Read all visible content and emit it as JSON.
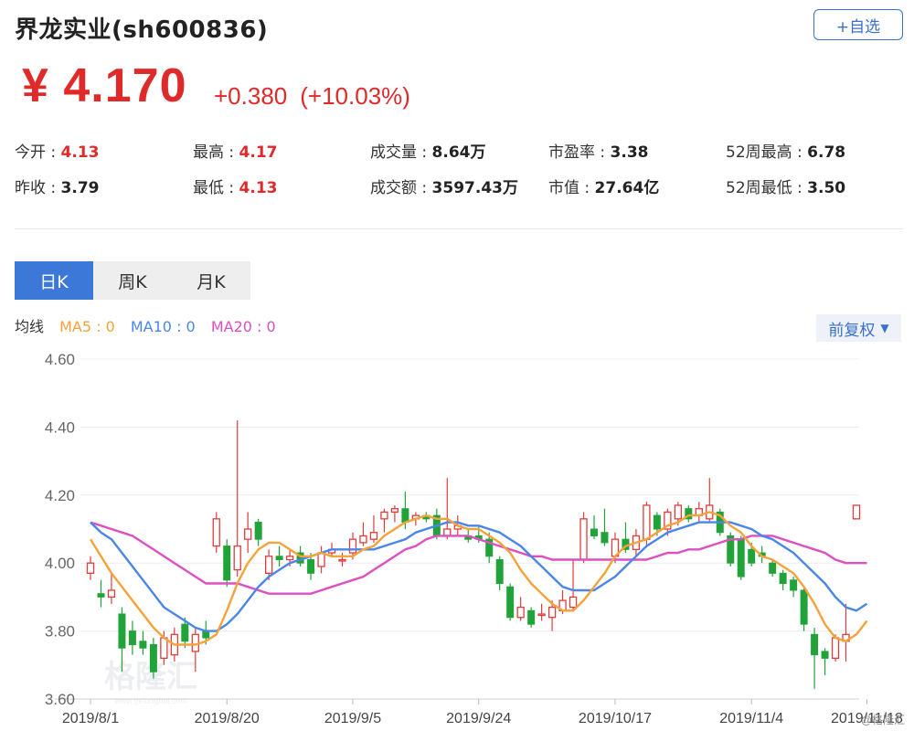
{
  "header": {
    "title": "界龙实业(sh600836)",
    "follow_label": "+自选"
  },
  "quote": {
    "price": "¥ 4.170",
    "change": "+0.380",
    "change_pct": "(+10.03%)"
  },
  "stats": [
    [
      {
        "label": "今开 : ",
        "value": "4.13",
        "red": true
      },
      {
        "label": "最高 : ",
        "value": "4.17",
        "red": true
      },
      {
        "label": "成交量 : ",
        "value": "8.64万",
        "red": false
      },
      {
        "label": "市盈率 : ",
        "value": "3.38",
        "red": false
      },
      {
        "label": "52周最高 : ",
        "value": "6.78",
        "red": false
      }
    ],
    [
      {
        "label": "昨收 : ",
        "value": "3.79",
        "red": false
      },
      {
        "label": "最低 : ",
        "value": "4.13",
        "red": true
      },
      {
        "label": "成交额 : ",
        "value": "3597.43万",
        "red": false
      },
      {
        "label": "市值 : ",
        "value": "27.64亿",
        "red": false
      },
      {
        "label": "52周最低 : ",
        "value": "3.50",
        "red": false
      }
    ]
  ],
  "tabs": [
    "日K",
    "周K",
    "月K"
  ],
  "active_tab": 0,
  "ma_legend": {
    "title": "均线",
    "ma5": "MA5 : 0",
    "ma10": "MA10 : 0",
    "ma20": "MA20 : 0"
  },
  "adjust_label": "前复权",
  "watermark": {
    "main": "格隆汇",
    "sub": "www.gelonghui.com"
  },
  "corner_watermark": "@格隆汇",
  "colors": {
    "up": "#e03c3c",
    "down": "#22a33a",
    "ma5": "#f5a23a",
    "ma10": "#4a86e8",
    "ma20": "#de4fc0",
    "accent": "#3b78d8"
  },
  "chart_data": {
    "type": "candlestick",
    "y_ticks": [
      "4.60",
      "4.40",
      "4.20",
      "4.00",
      "3.80",
      "3.60"
    ],
    "ylim": [
      3.6,
      4.6
    ],
    "x_tick_labels": [
      {
        "index": 0,
        "label": "2019/8/1"
      },
      {
        "index": 13,
        "label": "2019/8/20"
      },
      {
        "index": 25,
        "label": "2019/9/5"
      },
      {
        "index": 37,
        "label": "2019/9/24"
      },
      {
        "index": 50,
        "label": "2019/10/17"
      },
      {
        "index": 63,
        "label": "2019/11/4"
      },
      {
        "index": 74,
        "label": "2019/11/18"
      }
    ],
    "candles": [
      {
        "o": 3.97,
        "c": 4.0,
        "h": 4.02,
        "l": 3.95
      },
      {
        "o": 3.91,
        "c": 3.9,
        "h": 3.95,
        "l": 3.87
      },
      {
        "o": 3.9,
        "c": 3.92,
        "h": 3.97,
        "l": 3.88
      },
      {
        "o": 3.85,
        "c": 3.75,
        "h": 3.87,
        "l": 3.68
      },
      {
        "o": 3.8,
        "c": 3.76,
        "h": 3.83,
        "l": 3.73
      },
      {
        "o": 3.77,
        "c": 3.75,
        "h": 3.8,
        "l": 3.73
      },
      {
        "o": 3.76,
        "c": 3.68,
        "h": 3.78,
        "l": 3.66
      },
      {
        "o": 3.72,
        "c": 3.78,
        "h": 3.8,
        "l": 3.7
      },
      {
        "o": 3.73,
        "c": 3.79,
        "h": 3.81,
        "l": 3.71
      },
      {
        "o": 3.82,
        "c": 3.77,
        "h": 3.84,
        "l": 3.75
      },
      {
        "o": 3.74,
        "c": 3.79,
        "h": 3.81,
        "l": 3.68
      },
      {
        "o": 3.8,
        "c": 3.78,
        "h": 3.83,
        "l": 3.76
      },
      {
        "o": 4.05,
        "c": 4.13,
        "h": 4.15,
        "l": 4.03
      },
      {
        "o": 4.05,
        "c": 3.95,
        "h": 4.07,
        "l": 3.93
      },
      {
        "o": 3.98,
        "c": 4.05,
        "h": 4.42,
        "l": 3.96
      },
      {
        "o": 4.07,
        "c": 4.1,
        "h": 4.15,
        "l": 4.03
      },
      {
        "o": 4.12,
        "c": 4.07,
        "h": 4.13,
        "l": 4.05
      },
      {
        "o": 3.97,
        "c": 4.02,
        "h": 4.04,
        "l": 3.95
      },
      {
        "o": 4.02,
        "c": 4.01,
        "h": 4.05,
        "l": 3.99
      },
      {
        "o": 4.01,
        "c": 4.02,
        "h": 4.04,
        "l": 3.99
      },
      {
        "o": 4.03,
        "c": 4.0,
        "h": 4.05,
        "l": 3.99
      },
      {
        "o": 4.01,
        "c": 3.97,
        "h": 4.03,
        "l": 3.95
      },
      {
        "o": 3.99,
        "c": 4.03,
        "h": 4.05,
        "l": 3.97
      },
      {
        "o": 4.03,
        "c": 4.04,
        "h": 4.06,
        "l": 4.02
      },
      {
        "o": 4.01,
        "c": 4.01,
        "h": 4.03,
        "l": 3.99
      },
      {
        "o": 4.03,
        "c": 4.07,
        "h": 4.09,
        "l": 4.01
      },
      {
        "o": 4.06,
        "c": 4.08,
        "h": 4.12,
        "l": 4.05
      },
      {
        "o": 4.07,
        "c": 4.09,
        "h": 4.14,
        "l": 4.06
      },
      {
        "o": 4.13,
        "c": 4.15,
        "h": 4.16,
        "l": 4.09
      },
      {
        "o": 4.15,
        "c": 4.16,
        "h": 4.17,
        "l": 4.12
      },
      {
        "o": 4.16,
        "c": 4.12,
        "h": 4.21,
        "l": 4.1
      },
      {
        "o": 4.13,
        "c": 4.14,
        "h": 4.15,
        "l": 4.11
      },
      {
        "o": 4.14,
        "c": 4.13,
        "h": 4.15,
        "l": 4.12
      },
      {
        "o": 4.14,
        "c": 4.08,
        "h": 4.16,
        "l": 4.07
      },
      {
        "o": 4.08,
        "c": 4.1,
        "h": 4.25,
        "l": 4.07
      },
      {
        "o": 4.1,
        "c": 4.11,
        "h": 4.14,
        "l": 4.08
      },
      {
        "o": 4.08,
        "c": 4.07,
        "h": 4.1,
        "l": 4.06
      },
      {
        "o": 4.08,
        "c": 4.07,
        "h": 4.11,
        "l": 4.06
      },
      {
        "o": 4.07,
        "c": 4.02,
        "h": 4.09,
        "l": 4.0
      },
      {
        "o": 4.01,
        "c": 3.94,
        "h": 4.02,
        "l": 3.92
      },
      {
        "o": 3.93,
        "c": 3.84,
        "h": 3.94,
        "l": 3.83
      },
      {
        "o": 3.84,
        "c": 3.87,
        "h": 3.9,
        "l": 3.83
      },
      {
        "o": 3.86,
        "c": 3.82,
        "h": 3.87,
        "l": 3.81
      },
      {
        "o": 3.85,
        "c": 3.85,
        "h": 3.88,
        "l": 3.83
      },
      {
        "o": 3.84,
        "c": 3.87,
        "h": 3.89,
        "l": 3.8
      },
      {
        "o": 3.86,
        "c": 3.89,
        "h": 3.92,
        "l": 3.85
      },
      {
        "o": 3.87,
        "c": 3.9,
        "h": 4.01,
        "l": 3.86
      },
      {
        "o": 4.01,
        "c": 4.13,
        "h": 4.15,
        "l": 4.0
      },
      {
        "o": 4.1,
        "c": 4.08,
        "h": 4.14,
        "l": 4.07
      },
      {
        "o": 4.09,
        "c": 4.06,
        "h": 4.16,
        "l": 4.05
      },
      {
        "o": 4.02,
        "c": 4.07,
        "h": 4.09,
        "l": 4.0
      },
      {
        "o": 4.07,
        "c": 4.04,
        "h": 4.12,
        "l": 4.03
      },
      {
        "o": 4.04,
        "c": 4.08,
        "h": 4.1,
        "l": 4.02
      },
      {
        "o": 4.07,
        "c": 4.17,
        "h": 4.18,
        "l": 4.05
      },
      {
        "o": 4.14,
        "c": 4.1,
        "h": 4.15,
        "l": 4.08
      },
      {
        "o": 4.1,
        "c": 4.15,
        "h": 4.16,
        "l": 4.08
      },
      {
        "o": 4.13,
        "c": 4.17,
        "h": 4.18,
        "l": 4.11
      },
      {
        "o": 4.16,
        "c": 4.13,
        "h": 4.17,
        "l": 4.12
      },
      {
        "o": 4.14,
        "c": 4.16,
        "h": 4.18,
        "l": 4.12
      },
      {
        "o": 4.13,
        "c": 4.17,
        "h": 4.25,
        "l": 4.12
      },
      {
        "o": 4.15,
        "c": 4.09,
        "h": 4.16,
        "l": 4.08
      },
      {
        "o": 4.08,
        "c": 4.0,
        "h": 4.09,
        "l": 3.99
      },
      {
        "o": 4.07,
        "c": 3.96,
        "h": 4.08,
        "l": 3.95
      },
      {
        "o": 4.04,
        "c": 4.0,
        "h": 4.06,
        "l": 3.99
      },
      {
        "o": 4.03,
        "c": 4.02,
        "h": 4.05,
        "l": 4.0
      },
      {
        "o": 4.0,
        "c": 3.97,
        "h": 4.01,
        "l": 3.96
      },
      {
        "o": 3.97,
        "c": 3.94,
        "h": 3.98,
        "l": 3.92
      },
      {
        "o": 3.95,
        "c": 3.92,
        "h": 3.96,
        "l": 3.9
      },
      {
        "o": 3.92,
        "c": 3.82,
        "h": 3.93,
        "l": 3.8
      },
      {
        "o": 3.79,
        "c": 3.73,
        "h": 3.81,
        "l": 3.63
      },
      {
        "o": 3.74,
        "c": 3.72,
        "h": 3.75,
        "l": 3.67
      },
      {
        "o": 3.72,
        "c": 3.78,
        "h": 3.79,
        "l": 3.71
      },
      {
        "o": 3.77,
        "c": 3.79,
        "h": 3.88,
        "l": 3.71
      },
      {
        "o": 4.13,
        "c": 4.17,
        "h": 4.17,
        "l": 4.13
      }
    ],
    "ma5": [
      4.07,
      4.02,
      3.97,
      3.93,
      3.89,
      3.85,
      3.81,
      3.78,
      3.76,
      3.76,
      3.76,
      3.77,
      3.79,
      3.86,
      3.94,
      4.0,
      4.04,
      4.06,
      4.06,
      4.04,
      4.02,
      4.02,
      4.03,
      4.02,
      4.02,
      4.02,
      4.04,
      4.05,
      4.08,
      4.1,
      4.12,
      4.13,
      4.14,
      4.13,
      4.13,
      4.11,
      4.1,
      4.1,
      4.08,
      4.06,
      4.03,
      3.98,
      3.94,
      3.91,
      3.88,
      3.86,
      3.86,
      3.89,
      3.93,
      3.97,
      4.02,
      4.05,
      4.06,
      4.07,
      4.09,
      4.11,
      4.12,
      4.14,
      4.14,
      4.15,
      4.14,
      4.11,
      4.09,
      4.05,
      4.02,
      4.01,
      3.99,
      3.97,
      3.93,
      3.88,
      3.82,
      3.78,
      3.77,
      3.79,
      3.83
    ],
    "ma10": [
      4.12,
      4.09,
      4.07,
      4.03,
      3.99,
      3.95,
      3.91,
      3.87,
      3.85,
      3.83,
      3.81,
      3.8,
      3.8,
      3.82,
      3.85,
      3.89,
      3.93,
      3.96,
      3.98,
      4.0,
      4.01,
      4.02,
      4.03,
      4.04,
      4.04,
      4.04,
      4.04,
      4.04,
      4.05,
      4.06,
      4.07,
      4.09,
      4.1,
      4.11,
      4.12,
      4.12,
      4.11,
      4.11,
      4.1,
      4.09,
      4.07,
      4.05,
      4.02,
      3.99,
      3.96,
      3.93,
      3.92,
      3.92,
      3.92,
      3.94,
      3.96,
      3.99,
      4.02,
      4.05,
      4.07,
      4.09,
      4.1,
      4.11,
      4.12,
      4.12,
      4.12,
      4.12,
      4.11,
      4.1,
      4.08,
      4.07,
      4.05,
      4.03,
      4.0,
      3.97,
      3.94,
      3.9,
      3.87,
      3.86,
      3.88
    ],
    "ma20": [
      4.12,
      4.11,
      4.1,
      4.09,
      4.08,
      4.06,
      4.04,
      4.02,
      4.0,
      3.98,
      3.96,
      3.94,
      3.94,
      3.94,
      3.94,
      3.93,
      3.92,
      3.91,
      3.91,
      3.91,
      3.91,
      3.91,
      3.92,
      3.93,
      3.94,
      3.95,
      3.96,
      3.98,
      4.0,
      4.02,
      4.04,
      4.05,
      4.07,
      4.08,
      4.08,
      4.08,
      4.08,
      4.07,
      4.06,
      4.05,
      4.04,
      4.03,
      4.02,
      4.02,
      4.01,
      4.01,
      4.01,
      4.01,
      4.01,
      4.01,
      4.01,
      4.01,
      4.01,
      4.01,
      4.02,
      4.03,
      4.03,
      4.04,
      4.04,
      4.05,
      4.06,
      4.07,
      4.07,
      4.08,
      4.08,
      4.08,
      4.07,
      4.06,
      4.05,
      4.04,
      4.03,
      4.01,
      4.0,
      4.0,
      4.0
    ]
  }
}
